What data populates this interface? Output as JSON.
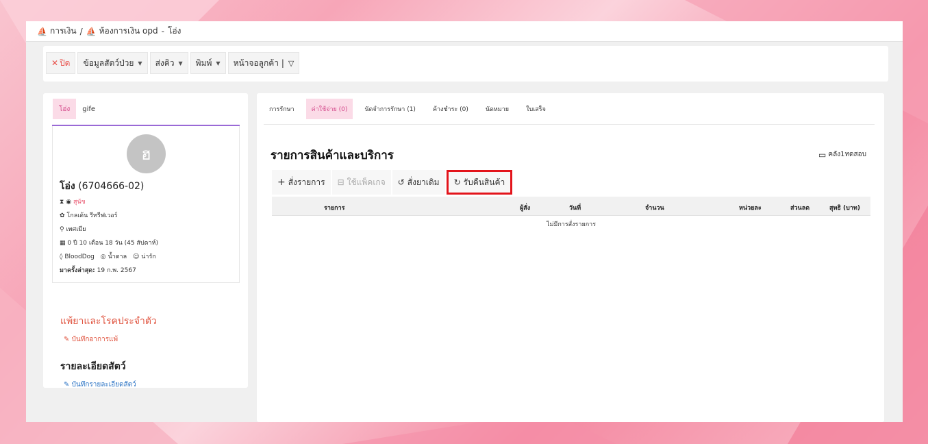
{
  "breadcrumb": {
    "item1": "การเงิน",
    "separator": "/",
    "item2": "ห้องการเงิน opd",
    "dash": "-",
    "item3": "โอ่ง"
  },
  "toolbar": {
    "close_label": "ปิด",
    "patient_info_label": "ข้อมูลสัตว์ป่วย",
    "queue_label": "ส่งคิว",
    "print_label": "พิมพ์",
    "customer_screen_label": "หน้าจอลูกค้า |"
  },
  "left_panel": {
    "tabs": [
      "โอ่ง",
      "gife"
    ],
    "avatar_letter": "ฮ",
    "pet_name": "โอ่ง",
    "pet_code": "(6704666-02)",
    "species": "สุนัข",
    "breed": "โกลเด้น รีทรีฟเวอร์",
    "sex": "เพศเมีย",
    "age": "0 ปี 10 เดือน 18 วัน (45 สัปดาห์)",
    "blood": "BloodDog",
    "color": "น้ำตาล",
    "temperament": "น่ารัก",
    "last_visit_label": "มาครั้งล่าสุด:",
    "last_visit_value": "19 ก.พ. 2567",
    "allergy_heading": "แพ้ยาและโรคประจำตัว",
    "allergy_link": "บันทึกอาการแพ้",
    "detail_heading": "รายละเอียดสัตว์",
    "detail_link": "บันทึกรายละเอียดสัตว์"
  },
  "right_panel": {
    "tabs": [
      "การรักษา",
      "ค่าใช้จ่าย (0)",
      "นัดจำการรักษา (1)",
      "ค้างชำระ (0)",
      "นัดหมาย",
      "ใบเสร็จ"
    ],
    "title": "รายการสินค้าและบริการ",
    "archive_label": "คลัง1ทดสอบ",
    "actions": {
      "order": "สั่งรายการ",
      "package": "ใช้แพ็คเกจ",
      "reorder": "สั่งยาเดิม",
      "return": "รับคืนสินค้า"
    },
    "table": {
      "headers": [
        "รายการ",
        "ผู้สั่ง",
        "วันที่",
        "จำนวน",
        "หน่วยละ",
        "ส่วนลด",
        "สุทธิ (บาท)"
      ],
      "empty_message": "ไม่มีการสั่งรายการ"
    }
  },
  "colors": {
    "accent_pink": "#d4478a",
    "highlight_red": "#e3141b",
    "danger_red": "#e0533e",
    "link_blue": "#2a73c4",
    "tab_underline": "#9a6ad6"
  }
}
